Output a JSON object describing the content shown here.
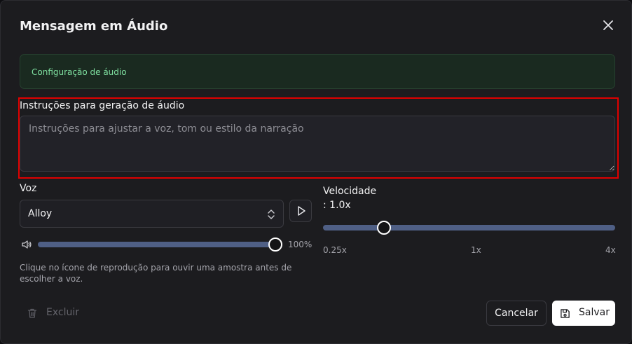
{
  "dialog": {
    "title": "Mensagem em Áudio",
    "close_icon": "close-icon"
  },
  "config_banner": {
    "text": "Configuração de áudio"
  },
  "instructions": {
    "label": "Instruções para geração de áudio",
    "placeholder": "Instruções para ajustar a voz, tom ou estilo da narração",
    "value": ""
  },
  "voice": {
    "label": "Voz",
    "selected": "Alloy",
    "play_icon": "play-icon",
    "volume_icon": "volume-icon",
    "volume_value": 1.0,
    "volume_text": "100%",
    "hint": "Clique no ícone de reprodução para ouvir uma amostra antes de escolher a voz."
  },
  "speed": {
    "label": "Velocidade",
    "value_text": ": 1.0x",
    "min_label": "0.25x",
    "mid_label": "1x",
    "max_label": "4x",
    "value_fraction": 0.21
  },
  "footer": {
    "delete_label": "Excluir",
    "delete_icon": "trash-icon",
    "cancel_label": "Cancelar",
    "save_label": "Salvar",
    "save_icon": "save-icon"
  },
  "colors": {
    "background": "#1c1c1f",
    "accent_green": "#7fe0a0",
    "slider_track": "#4f5f85",
    "highlight_red": "#e00000"
  }
}
